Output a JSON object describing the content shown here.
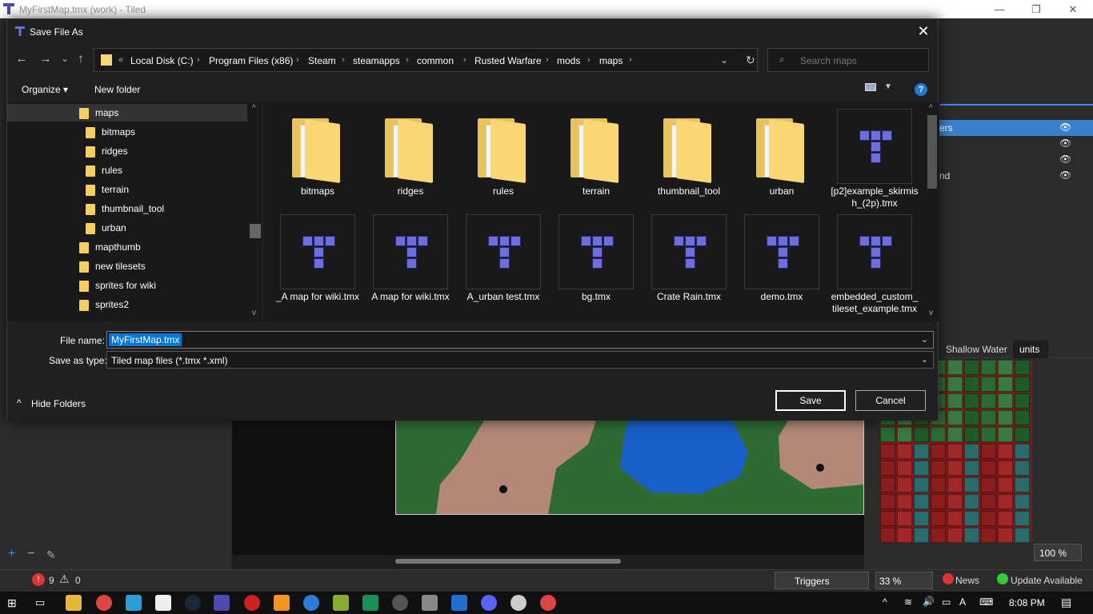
{
  "app": {
    "title": "MyFirstMap.tmx (work) - Tiled"
  },
  "dialog": {
    "title": "Save File As",
    "close_symbol": "✕",
    "nav": {
      "back": "←",
      "forward": "→",
      "recent": "⌄",
      "up": "↑"
    },
    "breadcrumb": [
      "Local Disk (C:)",
      "Program Files (x86)",
      "Steam",
      "steamapps",
      "common",
      "Rusted Warfare",
      "mods",
      "maps"
    ],
    "breadcrumb_prefix": "«",
    "search_placeholder": "Search maps",
    "toolbar": {
      "organize": "Organize ▾",
      "new_folder": "New folder",
      "help": "?"
    },
    "tree": [
      {
        "label": "maps",
        "indent": 1,
        "selected": true
      },
      {
        "label": "bitmaps",
        "indent": 2
      },
      {
        "label": "ridges",
        "indent": 2
      },
      {
        "label": "rules",
        "indent": 2
      },
      {
        "label": "terrain",
        "indent": 2
      },
      {
        "label": "thumbnail_tool",
        "indent": 2
      },
      {
        "label": "urban",
        "indent": 2
      },
      {
        "label": "mapthumb",
        "indent": 1
      },
      {
        "label": "new tilesets",
        "indent": 1
      },
      {
        "label": "sprites for wiki",
        "indent": 1
      },
      {
        "label": "sprites2",
        "indent": 1
      }
    ],
    "files_row1": [
      {
        "label": "bitmaps",
        "kind": "folder"
      },
      {
        "label": "ridges",
        "kind": "folder"
      },
      {
        "label": "rules",
        "kind": "folder"
      },
      {
        "label": "terrain",
        "kind": "folder"
      },
      {
        "label": "thumbnail_tool",
        "kind": "folder"
      },
      {
        "label": "urban",
        "kind": "folder"
      },
      {
        "label": "[p2]example_skirmish_(2p).tmx",
        "kind": "tmx"
      }
    ],
    "files_row2": [
      {
        "label": "_A map for wiki.tmx",
        "kind": "tmx"
      },
      {
        "label": "A map for wiki.tmx",
        "kind": "tmx"
      },
      {
        "label": "A_urban test.tmx",
        "kind": "tmx"
      },
      {
        "label": "bg.tmx",
        "kind": "tmx"
      },
      {
        "label": "Crate Rain.tmx",
        "kind": "tmx"
      },
      {
        "label": "demo.tmx",
        "kind": "tmx"
      },
      {
        "label": "embedded_custom_tileset_example.tmx",
        "kind": "tmx"
      }
    ],
    "file_name_label": "File name:",
    "file_name_value": "MyFirstMap.tmx",
    "save_type_label": "Save as type:",
    "save_type_value": "Tiled map files (*.tmx *.xml)",
    "hide_folders": "Hide Folders",
    "save": "Save",
    "cancel": "Cancel"
  },
  "right_panel": {
    "layer_labels": [
      "ers",
      "nd"
    ],
    "tileset_tabs": [
      "Shallow Water",
      "units"
    ],
    "zoom_value": "100 %"
  },
  "status": {
    "errors": "9",
    "warnings": "0",
    "triggers": "Triggers",
    "zoom": "33 %",
    "news": "News",
    "update": "Update Available"
  },
  "taskbar": {
    "time": "8:08 PM"
  },
  "colors": {
    "accent": "#0078d7",
    "folder": "#f8d774",
    "tiled_logo": "#6d6de0"
  }
}
